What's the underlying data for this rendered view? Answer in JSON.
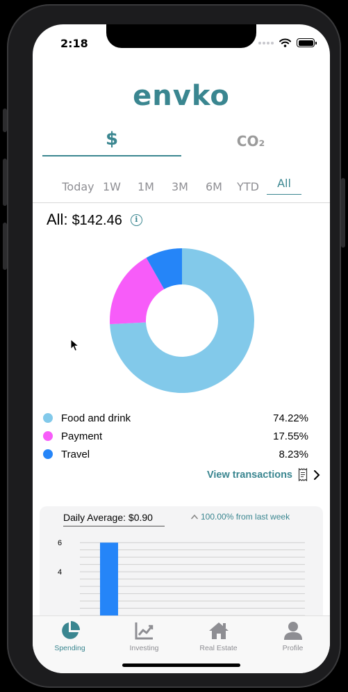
{
  "status": {
    "time": "2:18"
  },
  "app": {
    "logo": "envko"
  },
  "currency_tabs": [
    {
      "label": "$",
      "active": true
    },
    {
      "label": "CO₂",
      "active": false
    }
  ],
  "periods": [
    "Today",
    "1W",
    "1M",
    "3M",
    "6M",
    "YTD",
    "All"
  ],
  "active_period": "All",
  "summary": {
    "label": "All:",
    "amount": "$142.46",
    "info_icon": "i"
  },
  "legend": [
    {
      "name": "Food and drink",
      "percent": "74.22%",
      "color": "#82c9ea"
    },
    {
      "name": "Payment",
      "percent": "17.55%",
      "color": "#f75cf9"
    },
    {
      "name": "Travel",
      "percent": "8.23%",
      "color": "#2585f8"
    }
  ],
  "chart_data": [
    {
      "type": "pie",
      "title": "",
      "donut": true,
      "categories": [
        "Food and drink",
        "Payment",
        "Travel"
      ],
      "values": [
        74.22,
        17.55,
        8.23
      ],
      "colors": [
        "#82c9ea",
        "#f75cf9",
        "#2585f8"
      ]
    },
    {
      "type": "bar",
      "title": "",
      "categories": [
        ""
      ],
      "values": [
        6
      ],
      "y_ticks": [
        4,
        6
      ],
      "ylim": [
        0,
        6.2
      ],
      "color": "#2585f8",
      "grid": true
    }
  ],
  "view_transactions": {
    "label": "View transactions",
    "icon": "receipt-icon",
    "chevron": "chevron-right-icon"
  },
  "daily": {
    "label": "Daily Average: $0.90",
    "change": "100.00% from last week",
    "change_icon": "chevron-up-icon"
  },
  "tabbar": [
    {
      "label": "Spending",
      "icon": "pie-chart-icon",
      "active": true
    },
    {
      "label": "Investing",
      "icon": "line-chart-icon",
      "active": false
    },
    {
      "label": "Real Estate",
      "icon": "house-icon",
      "active": false
    },
    {
      "label": "Profile",
      "icon": "person-icon",
      "active": false
    }
  ],
  "colors": {
    "accent": "#3a8690",
    "tab_inactive": "#8e8e93"
  }
}
